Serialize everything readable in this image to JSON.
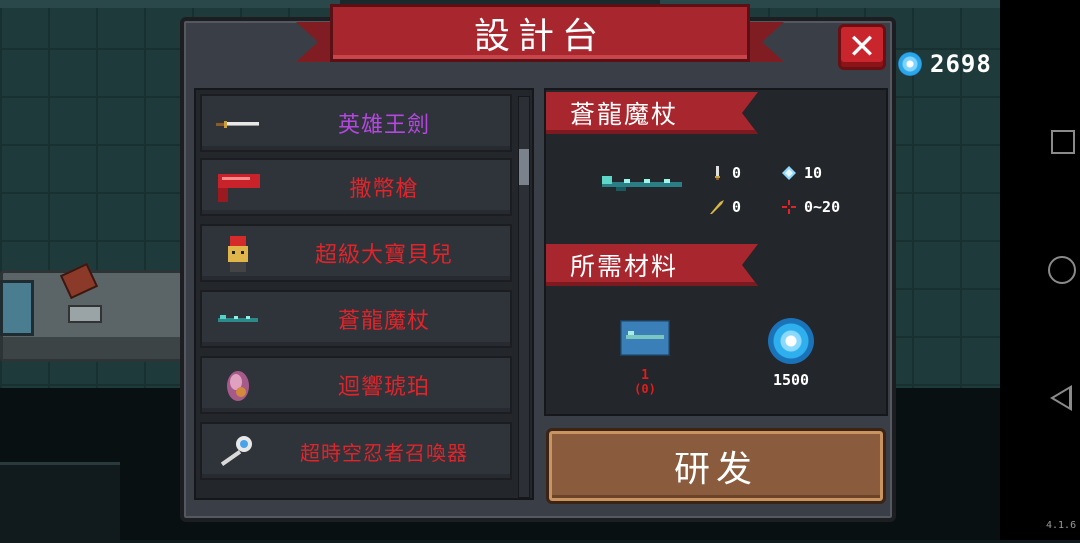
{
  "dialog": {
    "title": "設計台",
    "close_label": "✕",
    "research_button": "研发"
  },
  "currency": {
    "icon": "gem-icon",
    "value": "2698"
  },
  "items": [
    {
      "name": "英雄王劍",
      "color": "#b347e0",
      "icon": "sword-icon"
    },
    {
      "name": "撒幣槍",
      "color": "#e0242a",
      "icon": "gun-icon"
    },
    {
      "name": "超級大寶貝兒",
      "color": "#e0242a",
      "icon": "doll-icon"
    },
    {
      "name": "蒼龍魔杖",
      "color": "#e0242a",
      "icon": "staff-icon"
    },
    {
      "name": "迴響琥珀",
      "color": "#e0242a",
      "icon": "amber-icon"
    },
    {
      "name": "超時空忍者召喚器",
      "color": "#e0242a",
      "icon": "summoner-icon"
    }
  ],
  "selected": {
    "name": "蒼龍魔杖",
    "stats": {
      "damage": "0",
      "energy": "10",
      "crit": "0",
      "spread": "0~20"
    }
  },
  "materials_header": "所需材料",
  "materials": {
    "blueprint_have": "1",
    "blueprint_need": "(0)",
    "gems": "1500"
  },
  "version": "4.1.6",
  "colors": {
    "accent_red": "#a8262d",
    "panel": "#3a3f47",
    "rare_purple": "#b347e0",
    "rare_red": "#e0242a",
    "button_brown": "#8a5b3c"
  }
}
